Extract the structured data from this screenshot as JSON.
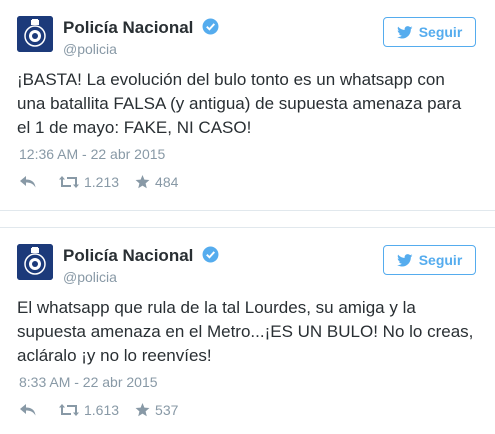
{
  "colors": {
    "accent": "#55acee",
    "text": "#292f33",
    "muted": "#8899a6",
    "avatar": "#1c3a7a"
  },
  "tweets": [
    {
      "name": "Policía Nacional",
      "handle": "@policia",
      "follow_label": "Seguir",
      "text": "¡BASTA! La evolución del bulo tonto es un whatsapp con una batallita FALSA (y antigua) de supuesta amenaza para el 1 de mayo: FAKE, NI CASO!",
      "timestamp": "12:36 AM - 22 abr 2015",
      "retweets": "1.213",
      "favorites": "484",
      "icons": [
        "reply-icon",
        "retweet-icon",
        "star-icon"
      ]
    },
    {
      "name": "Policía Nacional",
      "handle": "@policia",
      "follow_label": "Seguir",
      "text": "El whatsapp que rula de la tal Lourdes, su amiga y la supuesta amenaza en el Metro...¡ES UN BULO! No lo creas, acláralo ¡y no lo reenvíes!",
      "timestamp": "8:33 AM - 22 abr 2015",
      "retweets": "1.613",
      "favorites": "537",
      "icons": [
        "reply-icon",
        "retweet-icon",
        "star-icon"
      ]
    }
  ]
}
